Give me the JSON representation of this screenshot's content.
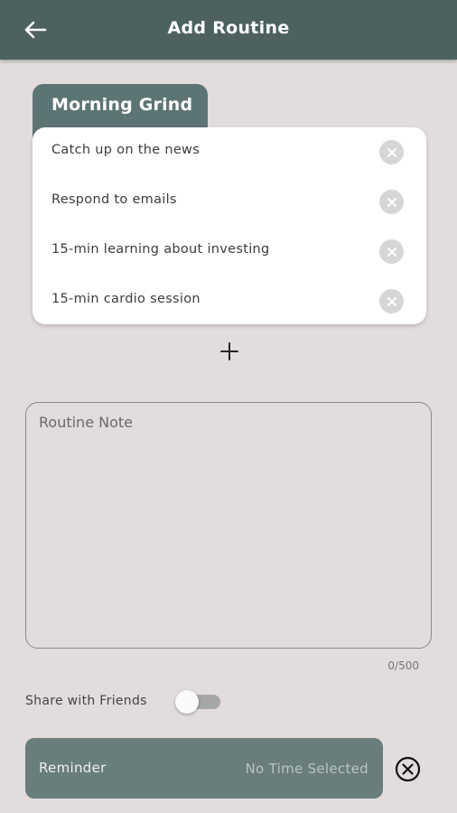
{
  "header": {
    "title": "Add Routine",
    "back_icon": "arrow-left-icon"
  },
  "routine": {
    "name": "Morning Grind",
    "tasks": [
      {
        "label": "Catch up on the news"
      },
      {
        "label": "Respond to emails"
      },
      {
        "label": "15-min learning about investing"
      },
      {
        "label": "15-min cardio session"
      }
    ],
    "remove_icon": "close-circle-icon",
    "add_icon": "plus-icon"
  },
  "note": {
    "placeholder": "Routine Note",
    "value": "",
    "char_count": "0/500"
  },
  "share": {
    "label": "Share with Friends",
    "enabled": false
  },
  "reminder": {
    "label": "Reminder",
    "value": "No Time Selected",
    "clear_icon": "close-circle-outline-icon"
  },
  "colors": {
    "app_bar": "#4d6161",
    "tab": "#5d7474",
    "background": "#e2dcdc",
    "reminder_bg": "#687d7c",
    "card": "#ffffff"
  }
}
